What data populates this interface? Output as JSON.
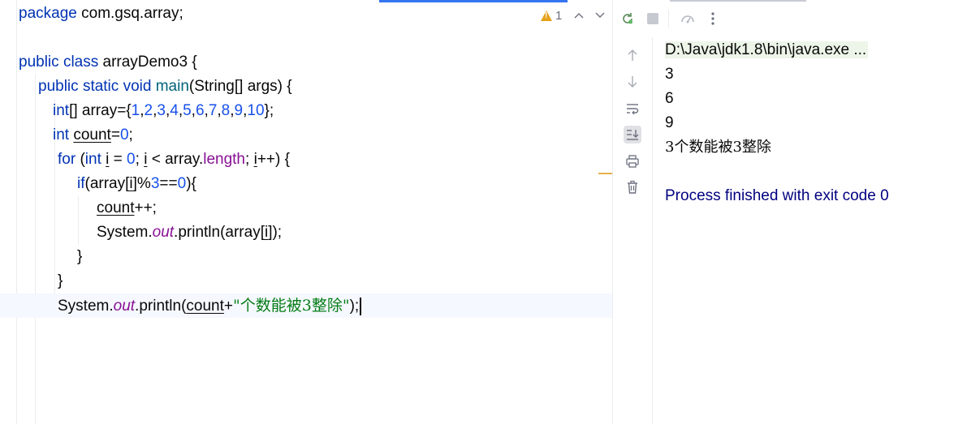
{
  "editor": {
    "warnings_count": "1",
    "lines": {
      "l1": {
        "kw": "package",
        "rest": " com.gsq.array;"
      },
      "l3": {
        "kw1": "public",
        "kw2": "class",
        "name": " arrayDemo3 {"
      },
      "l4": {
        "kw1": "public",
        "kw2": "static",
        "kw3": "void",
        "method": "main",
        "rest": "(String[] args) {"
      },
      "l5": {
        "kw": "int",
        "a": "[] array={",
        "n1": "1",
        "n2": "2",
        "n3": "3",
        "n4": "4",
        "n5": "5",
        "n6": "6",
        "n7": "7",
        "n8": "8",
        "n9": "9",
        "n10": "10",
        "end": "};"
      },
      "l6": {
        "kw": "int",
        "var": "count",
        "eq": "=",
        "num": "0",
        "end": ";"
      },
      "l7": {
        "kw1": "for",
        "p1": " (",
        "kw2": "int",
        "v1": "i",
        "p2": " = ",
        "num": "0",
        "p3": "; ",
        "v2": "i",
        "p4": " < array.",
        "fld": "length",
        "p5": "; ",
        "v3": "i",
        "p6": "++) {"
      },
      "l8": {
        "kw": "if",
        "p1": "(array[",
        "v": "i",
        "p2": "]%",
        "n1": "3",
        "p3": "==",
        "n2": "0",
        "p4": "){"
      },
      "l9": {
        "var": "count",
        "rest": "++;"
      },
      "l10": {
        "p1": "System.",
        "fld": "out",
        "p2": ".println(array[",
        "v": "i",
        "p3": "]);"
      },
      "l11": {
        "text": "}"
      },
      "l12": {
        "text": "}"
      },
      "l13": {
        "p1": "System.",
        "fld": "out",
        "p2": ".println(",
        "var": "count",
        "p3": "+",
        "str": "\"个数能被3整除\"",
        "p4": ");"
      }
    }
  },
  "run_panel": {
    "toolbar": {
      "rerun_icon": "rerun-icon",
      "stop_icon": "stop-icon",
      "profile_icon": "profiler-icon",
      "more_icon": "more-icon"
    },
    "side_icons": [
      "arrow-up-icon",
      "arrow-down-icon",
      "soft-wrap-icon",
      "scroll-to-end-icon",
      "print-icon",
      "trash-icon"
    ]
  },
  "console": {
    "command": "D:\\Java\\jdk1.8\\bin\\java.exe ...",
    "output": [
      "3",
      "6",
      "9",
      "3个数能被3整除"
    ],
    "exit_message": "Process finished with exit code 0"
  }
}
